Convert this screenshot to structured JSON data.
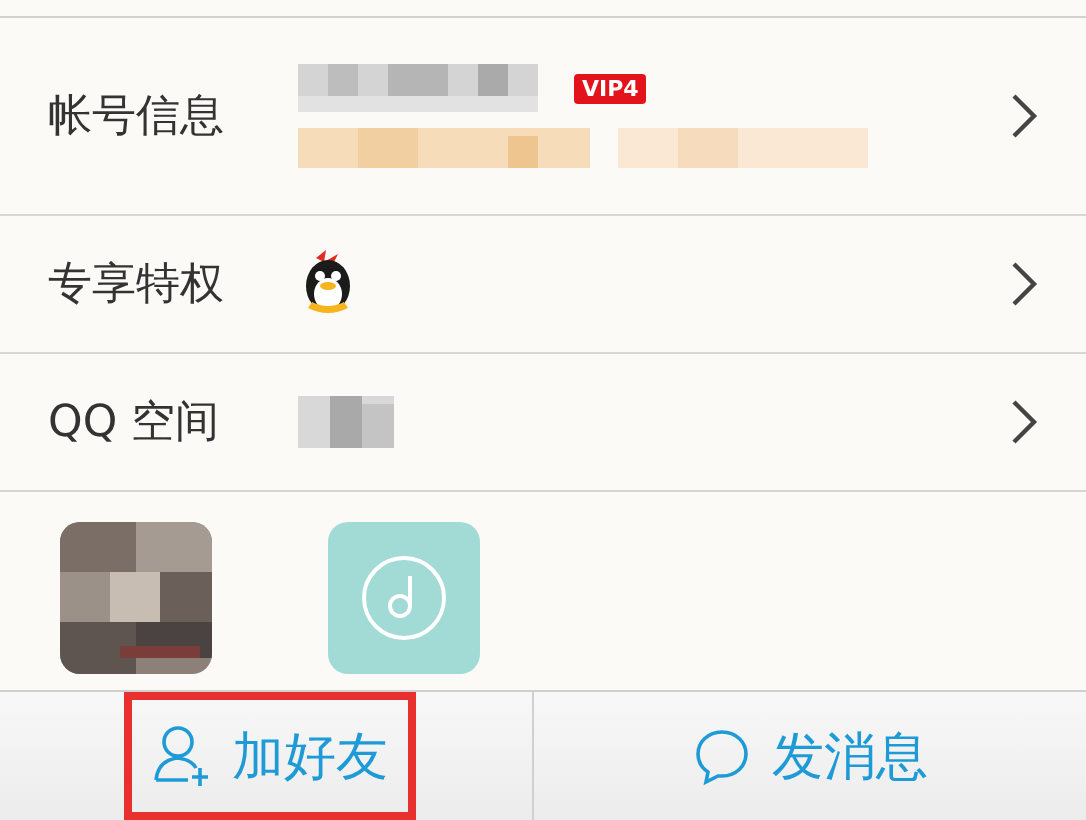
{
  "rows": [
    {
      "label": "帐号信息",
      "kind": "account",
      "badge": "VIP4"
    },
    {
      "label": "专享特权",
      "kind": "privilege"
    },
    {
      "label": "QQ 空间",
      "kind": "zone"
    }
  ],
  "tiles": [
    {
      "kind": "picture"
    },
    {
      "kind": "music"
    }
  ],
  "actions": [
    {
      "label": "加好友",
      "kind": "add-friend",
      "highlighted": true
    },
    {
      "label": "发消息",
      "kind": "message",
      "highlighted": false
    }
  ]
}
